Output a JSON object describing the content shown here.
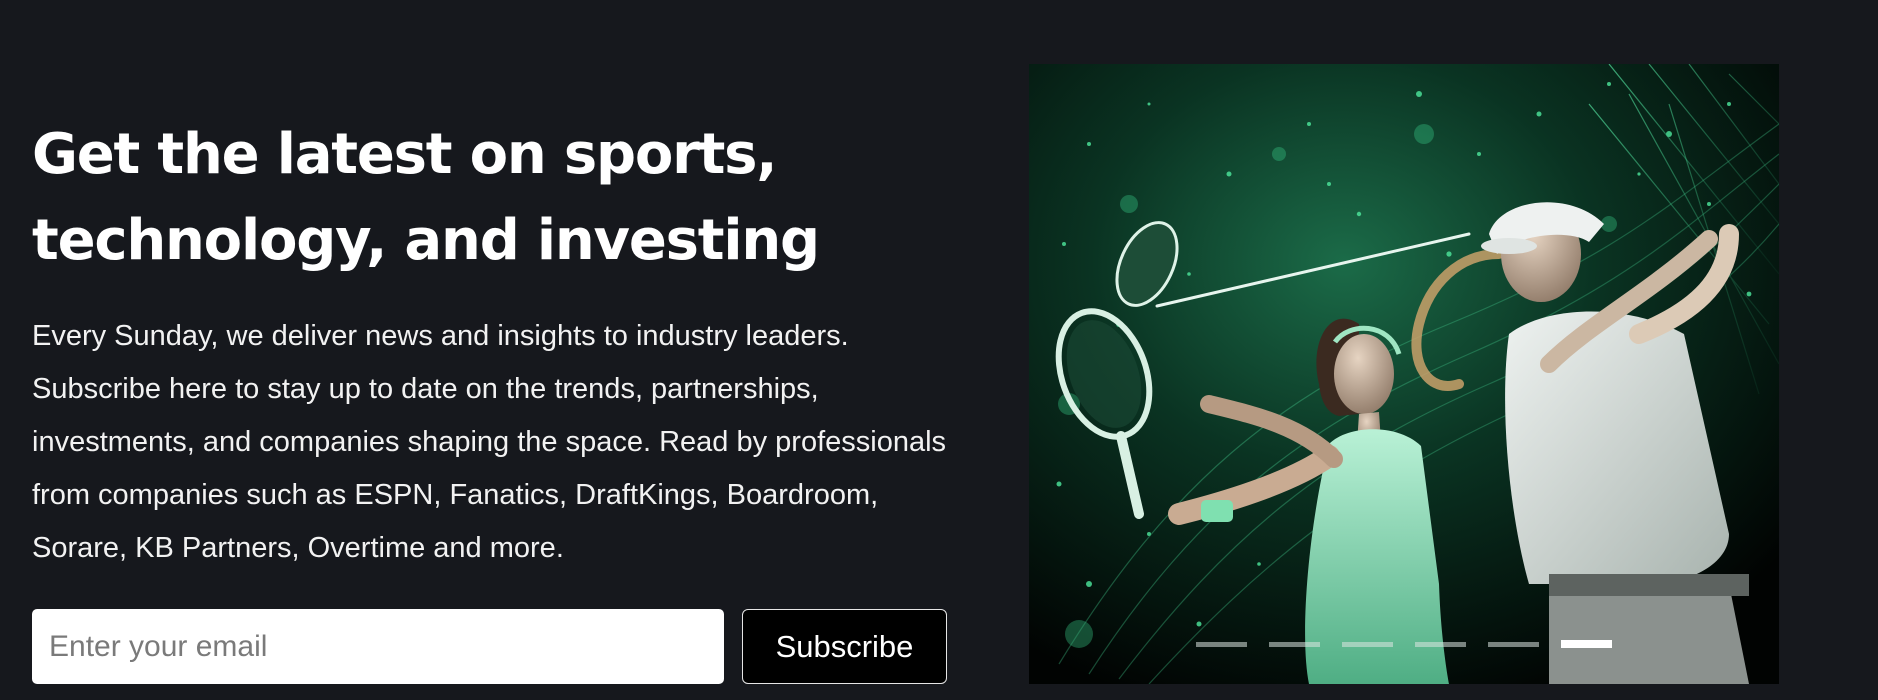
{
  "hero": {
    "headline": "Get the latest on sports, technology, and investing",
    "description": "Every Sunday, we deliver news and insights to industry leaders. Subscribe here to stay up to date on the trends, partnerships, investments, and companies shaping the space. Read by professionals from companies such as ESPN, Fanatics, DraftKings, Boardroom, Sorare, KB Partners, Overtime and more."
  },
  "signup": {
    "email_placeholder": "Enter your email",
    "subscribe_label": "Subscribe"
  },
  "carousel": {
    "slide_count": 6,
    "active_index": 5,
    "image_subject": "tennis player and golfer in green particle effects"
  },
  "colors": {
    "background": "#16181d",
    "accent_green": "#3ecf8e",
    "button_background": "#000000",
    "text": "#ffffff"
  }
}
